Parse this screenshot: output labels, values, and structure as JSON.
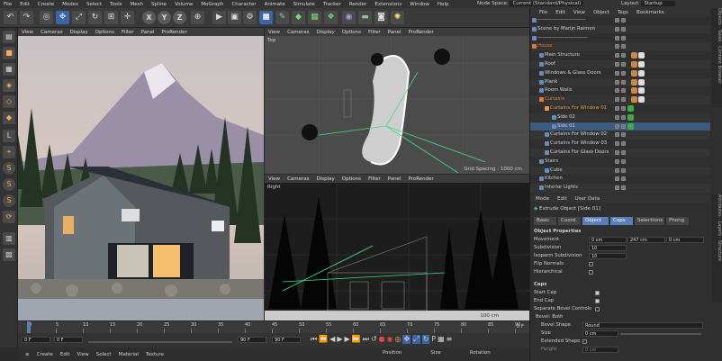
{
  "menu": [
    "File",
    "Edit",
    "Create",
    "Modes",
    "Select",
    "Tools",
    "Mesh",
    "Spline",
    "Volume",
    "MoGraph",
    "Character",
    "Animate",
    "Simulate",
    "Tracker",
    "Render",
    "Extensions",
    "Window",
    "Help"
  ],
  "node_space": {
    "label": "Node Space:",
    "value": "Current (Standard/Physical)"
  },
  "layout": {
    "label": "Layout:",
    "value": "Startup"
  },
  "axes": {
    "x": "X",
    "y": "Y",
    "z": "Z"
  },
  "viewport_menu": [
    "View",
    "Cameras",
    "Display",
    "Options",
    "Filter",
    "Panel",
    "ProRender"
  ],
  "viewport_top": {
    "label": "Top",
    "grid": "Grid Spacing : 1000 cm"
  },
  "viewport_right": {
    "label": "Right",
    "grid": "100 cm"
  },
  "timeline": {
    "ticks": [
      "0",
      "5",
      "10",
      "15",
      "20",
      "25",
      "30",
      "35",
      "40",
      "45",
      "50",
      "55",
      "60",
      "65",
      "70",
      "75",
      "80",
      "85",
      "90"
    ],
    "start": "0 F",
    "mid": "0 F",
    "end": "90 F",
    "end2": "90 F",
    "current": "0 F"
  },
  "material_menu": [
    "Create",
    "Edit",
    "View",
    "Select",
    "Material",
    "Texture"
  ],
  "coord_headers": [
    "Position",
    "Size",
    "Rotation"
  ],
  "objects_menu": [
    "File",
    "Edit",
    "View",
    "Object",
    "Tags",
    "Bookmarks"
  ],
  "objects": [
    {
      "name": "----------------------------",
      "indent": 8
    },
    {
      "name": "Scene by Marijn Raimen",
      "indent": 8
    },
    {
      "name": "-----------------------------",
      "indent": 8
    },
    {
      "name": "House",
      "indent": 8,
      "color": "#e07a3a"
    },
    {
      "name": "Main Structure",
      "indent": 16
    },
    {
      "name": "Roof",
      "indent": 16
    },
    {
      "name": "Windows & Glass Doors",
      "indent": 16
    },
    {
      "name": "Plank",
      "indent": 16
    },
    {
      "name": "Room Walls",
      "indent": 16
    },
    {
      "name": "Curtains",
      "indent": 16,
      "color": "#e07a3a"
    },
    {
      "name": "Curtains For Window 01",
      "indent": 22,
      "color": "#e09a4a"
    },
    {
      "name": "Side 02",
      "indent": 30
    },
    {
      "name": "Side 01",
      "indent": 30,
      "selected": true
    },
    {
      "name": "Curtains For Window 02",
      "indent": 22
    },
    {
      "name": "Curtains For Window 03",
      "indent": 22
    },
    {
      "name": "Curtains For Glass Doors",
      "indent": 22
    },
    {
      "name": "Stairs",
      "indent": 16
    },
    {
      "name": "Cube",
      "indent": 22
    },
    {
      "name": "Kitchen",
      "indent": 16
    },
    {
      "name": "Interior Lights",
      "indent": 16
    }
  ],
  "attr_menu": [
    "Mode",
    "Edit",
    "User Data"
  ],
  "attr_object": "Extrude Object [Side 01]",
  "attr_tabs": [
    "Basic",
    "Coord.",
    "Object",
    "Caps",
    "Selections",
    "Phong"
  ],
  "attr_active_tab": "Object",
  "object_props": {
    "header": "Object Properties",
    "movement_label": "Movement",
    "movement": [
      "0 cm",
      "247 cm",
      "0 cm"
    ],
    "subdivision_label": "Subdivision",
    "subdivision": "10",
    "isoparm_label": "Isoparm Subdivision",
    "isoparm": "10",
    "flip_normals": "Flip Normals",
    "hierarchical": "Hierarchical"
  },
  "caps": {
    "header": "Caps",
    "start_cap": "Start Cap",
    "end_cap": "End Cap",
    "separate_bevel": "Separate Bevel Controls",
    "bevel_both": "Bevel: Both",
    "bevel_shape_label": "Bevel Shape",
    "bevel_shape": "Round",
    "size_label": "Size",
    "size": "0 cm",
    "extended_shape": "Extended Shape",
    "height_label": "Height",
    "height": "0 cm"
  },
  "side_tabs": [
    "Objects",
    "Takes",
    "Content Browser",
    "Attributes",
    "Layers",
    "Structure"
  ],
  "colors": {
    "accent": "#5a7fb8",
    "orange": "#e07a3a",
    "active_tab": "#5a7fb8"
  }
}
